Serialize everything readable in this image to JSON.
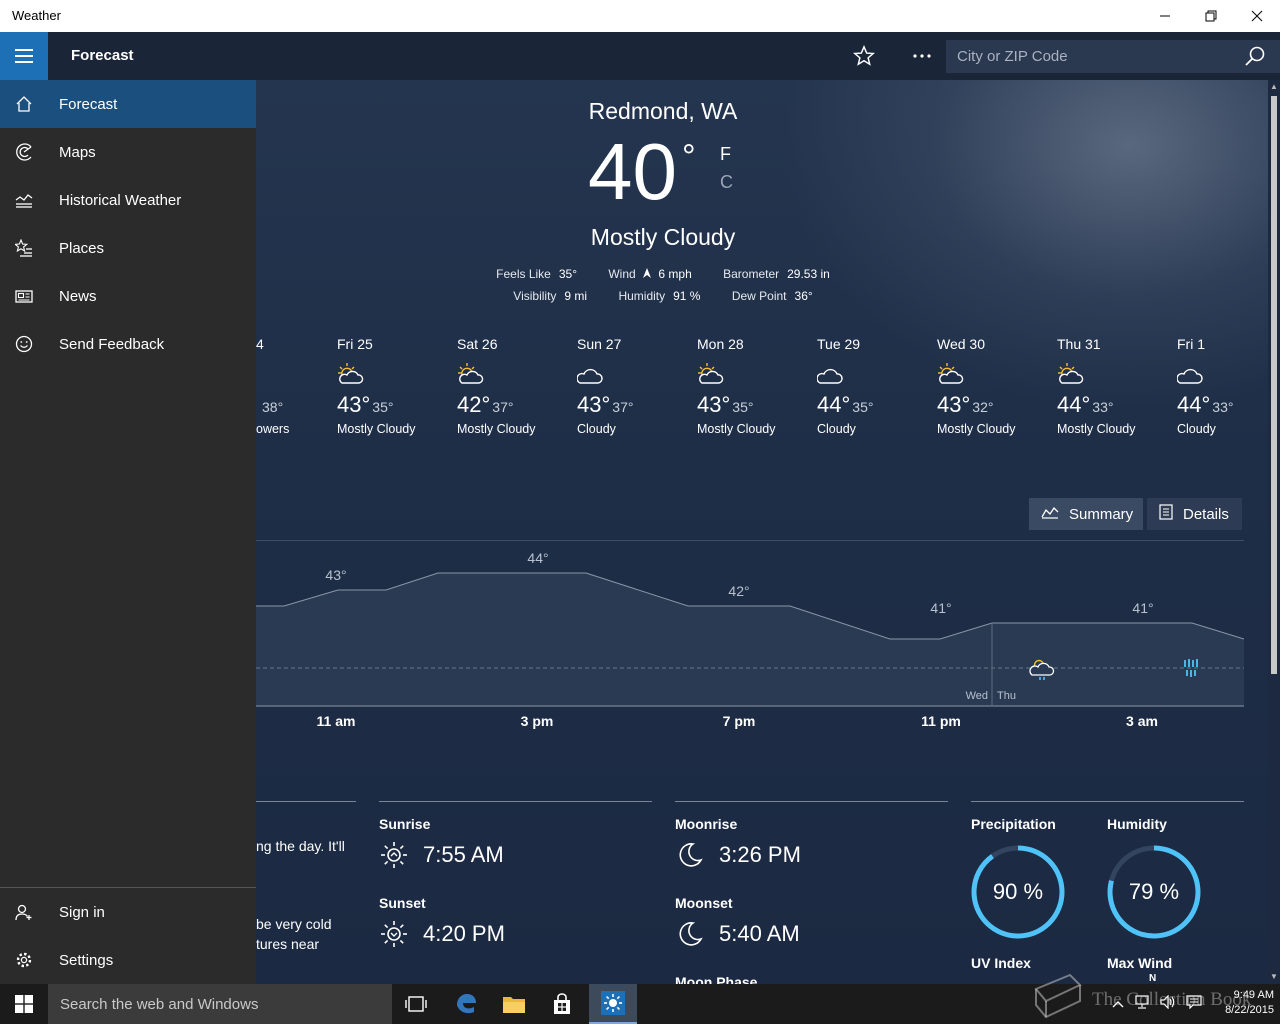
{
  "window": {
    "title": "Weather"
  },
  "appbar": {
    "title": "Forecast",
    "search_placeholder": "City or ZIP Code"
  },
  "sidebar": {
    "items": [
      {
        "label": "Forecast",
        "icon": "home-icon"
      },
      {
        "label": "Maps",
        "icon": "radar-icon"
      },
      {
        "label": "Historical Weather",
        "icon": "chart-icon"
      },
      {
        "label": "Places",
        "icon": "star-list-icon"
      },
      {
        "label": "News",
        "icon": "news-icon"
      },
      {
        "label": "Send Feedback",
        "icon": "smiley-icon"
      }
    ],
    "footer": [
      {
        "label": "Sign in",
        "icon": "person-add-icon"
      },
      {
        "label": "Settings",
        "icon": "gear-icon"
      }
    ]
  },
  "current": {
    "location": "Redmond, WA",
    "temp": "40",
    "deg": "°",
    "unit_f": "F",
    "unit_c": "C",
    "condition": "Mostly Cloudy",
    "feels_like_label": "Feels Like",
    "feels_like": "35°",
    "wind_label": "Wind",
    "wind": "6 mph",
    "barometer_label": "Barometer",
    "barometer": "29.53 in",
    "visibility_label": "Visibility",
    "visibility": "9 mi",
    "humidity_label": "Humidity",
    "humidity": "91 %",
    "dew_point_label": "Dew Point",
    "dew_point": "36°"
  },
  "daily": [
    {
      "day": "4",
      "high": "",
      "low": "38°",
      "cond": "owers",
      "icon": ""
    },
    {
      "day": "Fri 25",
      "high": "43°",
      "low": "35°",
      "cond": "Mostly Cloudy",
      "icon": "partly-cloudy"
    },
    {
      "day": "Sat 26",
      "high": "42°",
      "low": "37°",
      "cond": "Mostly Cloudy",
      "icon": "partly-cloudy"
    },
    {
      "day": "Sun 27",
      "high": "43°",
      "low": "37°",
      "cond": "Cloudy",
      "icon": "cloudy"
    },
    {
      "day": "Mon 28",
      "high": "43°",
      "low": "35°",
      "cond": "Mostly Cloudy",
      "icon": "partly-cloudy"
    },
    {
      "day": "Tue 29",
      "high": "44°",
      "low": "35°",
      "cond": "Cloudy",
      "icon": "cloudy"
    },
    {
      "day": "Wed 30",
      "high": "43°",
      "low": "32°",
      "cond": "Mostly Cloudy",
      "icon": "partly-cloudy"
    },
    {
      "day": "Thu 31",
      "high": "44°",
      "low": "33°",
      "cond": "Mostly Cloudy",
      "icon": "partly-cloudy"
    },
    {
      "day": "Fri 1",
      "high": "44°",
      "low": "33°",
      "cond": "Cloudy",
      "icon": "cloudy"
    }
  ],
  "tabs": {
    "summary": "Summary",
    "details": "Details"
  },
  "hourly": {
    "temp_labels": [
      "43°",
      "44°",
      "42°",
      "41°",
      "41°"
    ],
    "times": [
      "11 am",
      "3 pm",
      "7 pm",
      "11 pm",
      "3 am"
    ],
    "day_markers": [
      "Wed",
      "Thu"
    ]
  },
  "summary": {
    "line1": "ng the day. It'll",
    "line2": "be very cold",
    "line3": "tures near"
  },
  "sun": {
    "sunrise_label": "Sunrise",
    "sunrise": "7:55 AM",
    "sunset_label": "Sunset",
    "sunset": "4:20 PM"
  },
  "moon": {
    "moonrise_label": "Moonrise",
    "moonrise": "3:26 PM",
    "moonset_label": "Moonset",
    "moonset": "5:40 AM",
    "phase_label": "Moon Phase"
  },
  "stats": {
    "precip_label": "Precipitation",
    "precip": "90 %",
    "precip_fraction": 0.9,
    "humidity_label": "Humidity",
    "humidity": "79 %",
    "humidity_fraction": 0.79,
    "uv_label": "UV Index",
    "max_wind_label": "Max Wind",
    "wind_dir": "N"
  },
  "taskbar": {
    "search_placeholder": "Search the web and Windows",
    "time": "9:49 AM",
    "date": "8/22/2015"
  },
  "watermark": "The Collection Book",
  "colors": {
    "accent": "#1d6fb6",
    "gauge": "#4fc3f7",
    "sidebar": "#2b2b2b"
  }
}
